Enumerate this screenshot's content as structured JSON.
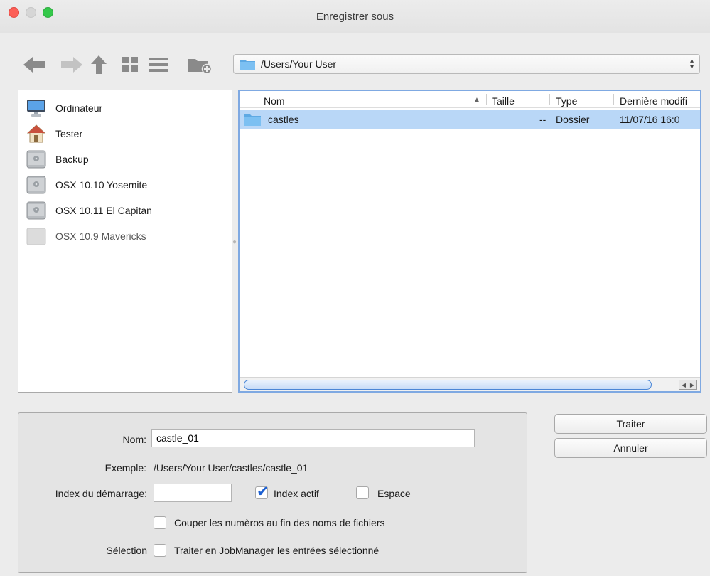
{
  "window": {
    "title": "Enregistrer sous"
  },
  "toolbar": {
    "icons": [
      "arrow-left-icon",
      "arrow-right-icon",
      "arrow-up-icon",
      "grid-view-icon",
      "list-view-icon",
      "new-folder-icon"
    ],
    "path": "/Users/Your User"
  },
  "sidebar": {
    "items": [
      {
        "label": "Ordinateur",
        "icon": "computer-icon"
      },
      {
        "label": "Tester",
        "icon": "home-icon"
      },
      {
        "label": "Backup",
        "icon": "disk-icon"
      },
      {
        "label": "OSX 10.10 Yosemite",
        "icon": "disk-icon"
      },
      {
        "label": "OSX 10.11 El Capitan",
        "icon": "disk-icon"
      },
      {
        "label": "OSX 10.9 Mavericks",
        "icon": "disk-icon",
        "disabled": true
      }
    ]
  },
  "browser": {
    "columns": [
      "Nom",
      "Taille",
      "Type",
      "Dernière modifi"
    ],
    "sort_indicator": "▲",
    "rows": [
      {
        "name": "castles",
        "size": "--",
        "type": "Dossier",
        "modified": "11/07/16 16:0"
      }
    ]
  },
  "form": {
    "name_label": "Nom:",
    "name_value": "castle_01",
    "example_label": "Exemple:",
    "example_value": "/Users/Your User/castles/castle_01",
    "start_index_label": "Index du démarrage:",
    "start_index_value": "",
    "index_active_label": "Index actif",
    "index_active_checked": true,
    "space_label": "Espace",
    "space_checked": false,
    "trim_label": "Couper les numèros au fin des noms de fichiers",
    "trim_checked": false,
    "selection_label": "Sélection",
    "selection_option_label": "Traiter en JobManager les entrées sélectionné",
    "selection_checked": false
  },
  "buttons": {
    "process_label": "Traiter",
    "cancel_label": "Annuler"
  },
  "colors": {
    "selection": "#b9d7f7",
    "focus_ring": "#7fa9e2",
    "close": "#fc5f57",
    "maximize": "#34c84a",
    "checkbox_accent": "#1b5fd1"
  }
}
